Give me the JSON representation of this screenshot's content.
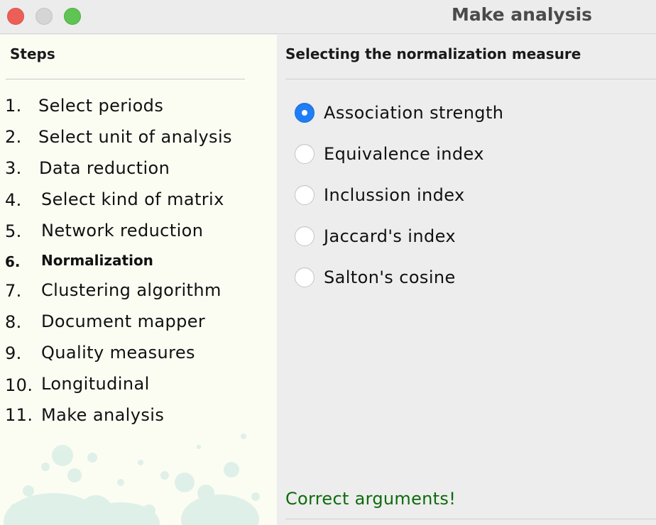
{
  "window": {
    "title": "Make analysis"
  },
  "sidebar": {
    "heading": "Steps",
    "steps": [
      {
        "number": "1.",
        "label": "Select periods",
        "active": false
      },
      {
        "number": "2.",
        "label": "Select unit of analysis",
        "active": false
      },
      {
        "number": "3.",
        "label": "Data reduction",
        "active": false
      },
      {
        "number": "4.",
        "label": "Select kind of matrix",
        "active": false
      },
      {
        "number": "5.",
        "label": "Network reduction",
        "active": false
      },
      {
        "number": "6.",
        "label": "Normalization",
        "active": true
      },
      {
        "number": "7.",
        "label": "Clustering algorithm",
        "active": false
      },
      {
        "number": "8.",
        "label": "Document mapper",
        "active": false
      },
      {
        "number": "9.",
        "label": "Quality measures",
        "active": false
      },
      {
        "number": "10.",
        "label": "Longitudinal",
        "active": false
      },
      {
        "number": "11.",
        "label": "Make analysis",
        "active": false
      }
    ]
  },
  "main": {
    "heading": "Selecting the normalization measure",
    "options": [
      {
        "label": "Association strength",
        "checked": true
      },
      {
        "label": "Equivalence index",
        "checked": false
      },
      {
        "label": "Inclussion index",
        "checked": false
      },
      {
        "label": "Jaccard's index",
        "checked": false
      },
      {
        "label": "Salton's cosine",
        "checked": false
      }
    ],
    "status": "Correct arguments!"
  },
  "colors": {
    "accent": "#1f7ef5",
    "status_text": "#0e6b0e",
    "sidebar_bg": "#fbfdf3"
  }
}
